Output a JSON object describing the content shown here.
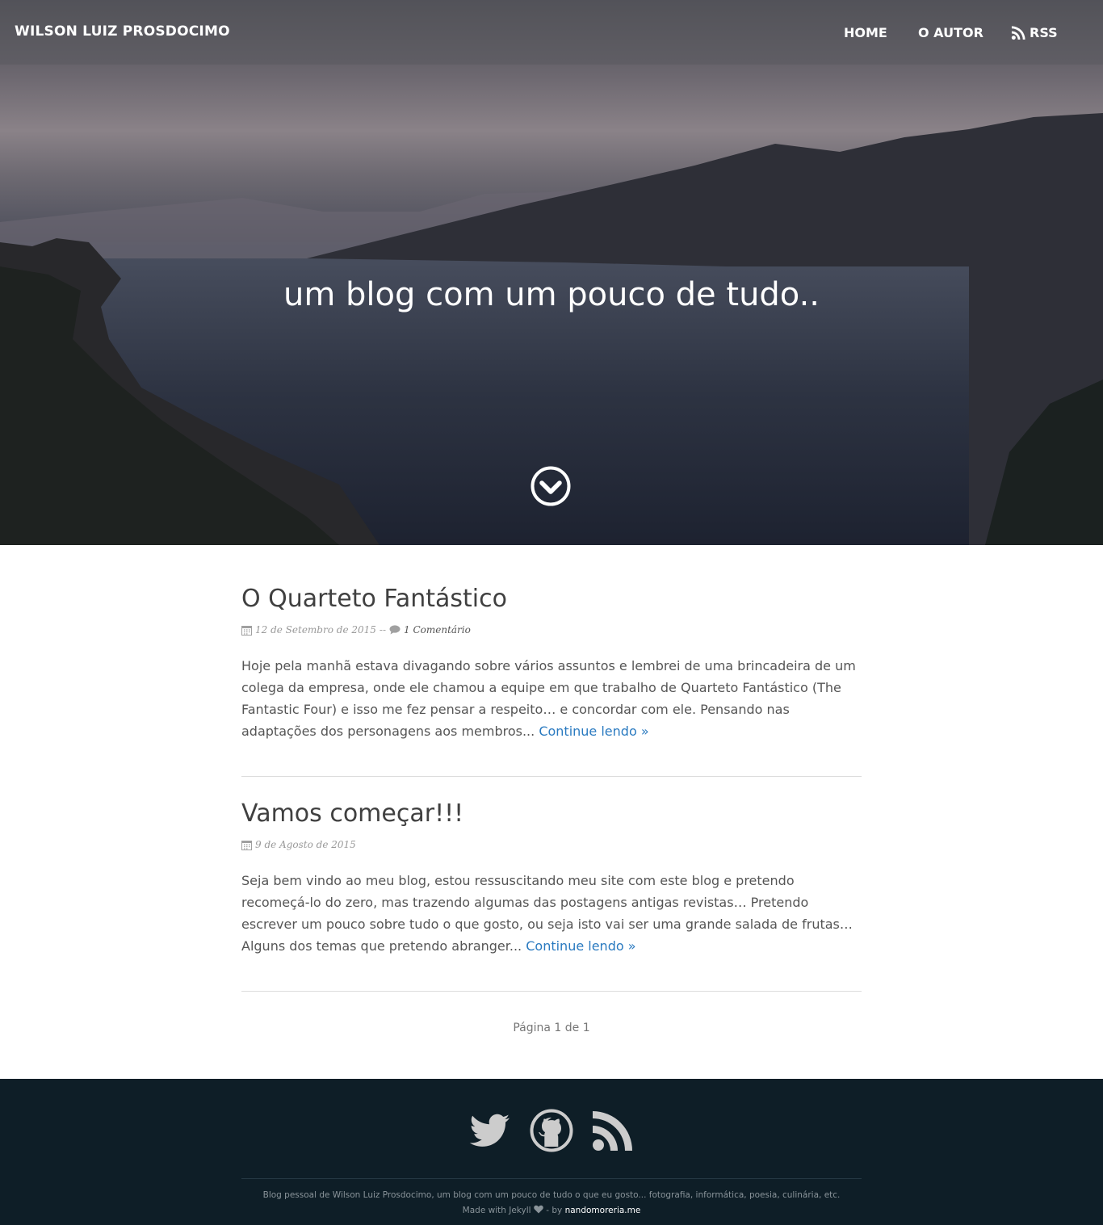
{
  "header": {
    "brand": "WILSON LUIZ PROSDOCIMO",
    "nav": {
      "home": "HOME",
      "autor": "O AUTOR",
      "rss": "RSS"
    }
  },
  "hero": {
    "tagline": "um blog com um pouco de tudo..",
    "scroll_icon": "chevron-down-circle-icon"
  },
  "posts": [
    {
      "title": "O Quarteto Fantástico",
      "date": "12 de Setembro de 2015",
      "separator": "--",
      "comments": "1 Comentário",
      "excerpt": "Hoje pela manhã estava divagando sobre vários assuntos e lembrei de uma brincadeira de um colega da empresa, onde ele chamou a equipe em que trabalho de Quarteto Fantástico (The Fantastic Four) e isso me fez pensar a respeito… e concordar com ele. Pensando nas adaptações dos personagens aos membros...",
      "more": "Continue lendo »"
    },
    {
      "title": "Vamos começar!!!",
      "date": "9 de Agosto de 2015",
      "excerpt": "Seja bem vindo ao meu blog, estou ressuscitando meu site com este blog e pretendo recomeçá-lo do zero, mas trazendo algumas das postagens antigas revistas… Pretendo escrever um pouco sobre tudo o que gosto, ou seja isto vai ser uma grande salada de frutas… Alguns dos temas que pretendo abranger...",
      "more": "Continue lendo »"
    }
  ],
  "pagination": "Página 1 de 1",
  "footer": {
    "social_icons": [
      "twitter-icon",
      "github-icon",
      "rss-icon"
    ],
    "description": "Blog pessoal de Wilson Luiz Prosdocimo, um blog com um pouco de tudo o que eu gosto... fotografia, informática, poesia, culinária, etc.",
    "made_with": "Made with Jekyll",
    "by": "- by",
    "author_link": "nandomoreria.me"
  },
  "colors": {
    "link": "#2a7ac0",
    "footer_bg": "#0e1e27",
    "social_icon": "#cccccc"
  }
}
